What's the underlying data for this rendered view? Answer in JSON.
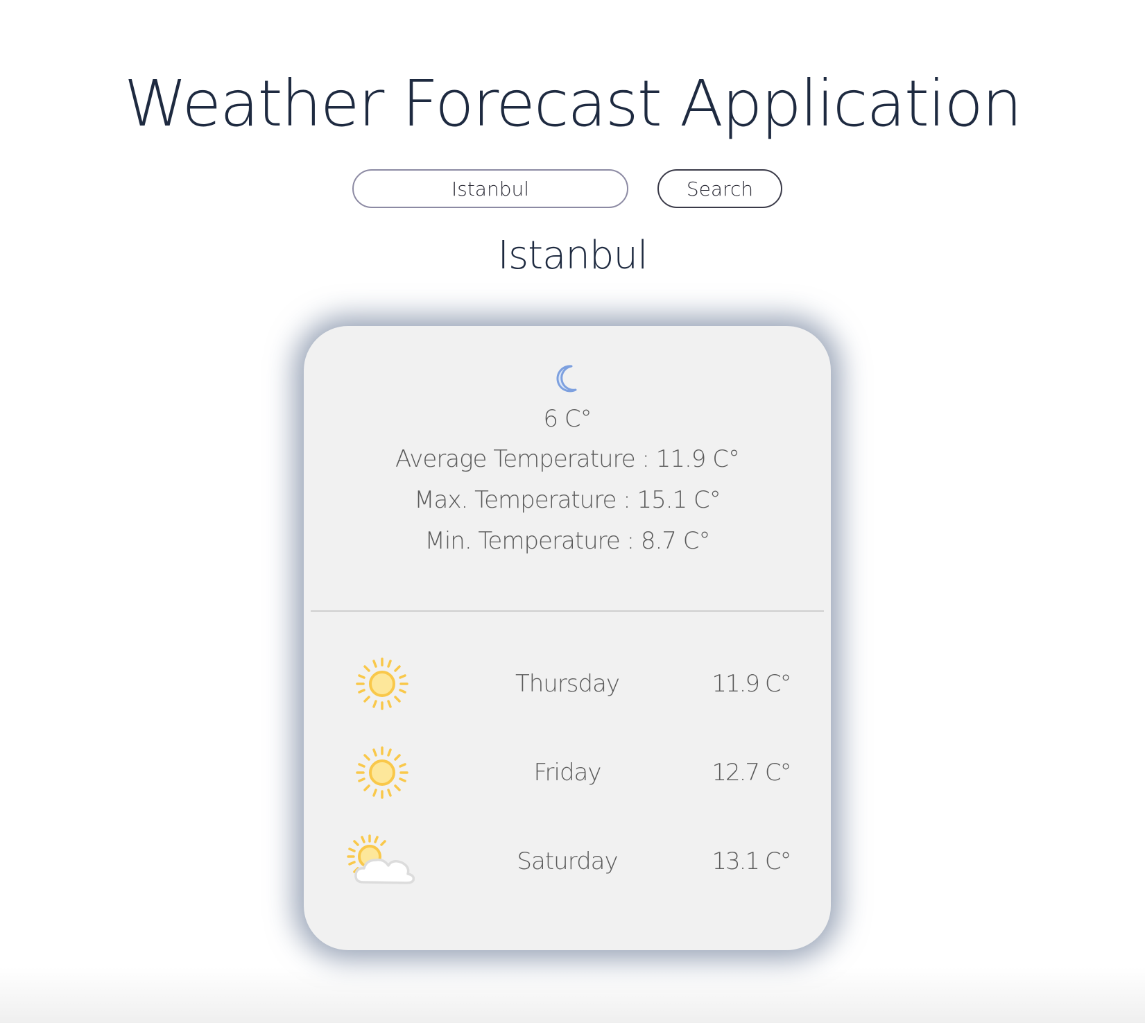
{
  "header": {
    "title": "Weather Forecast Application"
  },
  "search": {
    "value": "Istanbul",
    "button_label": "Search"
  },
  "city": {
    "name": "Istanbul"
  },
  "current": {
    "icon": "moon-icon",
    "temperature": "6 C°",
    "average": "Average Temperature : 11.9 C°",
    "max": "Max. Temperature : 15.1 C°",
    "min": "Min. Temperature : 8.7 C°"
  },
  "forecast": [
    {
      "icon": "sun-icon",
      "day": "Thursday",
      "temp": "11.9 C°"
    },
    {
      "icon": "sun-icon",
      "day": "Friday",
      "temp": "12.7 C°"
    },
    {
      "icon": "partly-cloudy-icon",
      "day": "Saturday",
      "temp": "13.1 C°"
    }
  ],
  "colors": {
    "title": "#1e2a40",
    "card_background": "#f1f1f1",
    "card_glow": "#7887a0",
    "text": "#5a5a5a",
    "moon": "#7da0df",
    "sun": "#f9c84a"
  }
}
